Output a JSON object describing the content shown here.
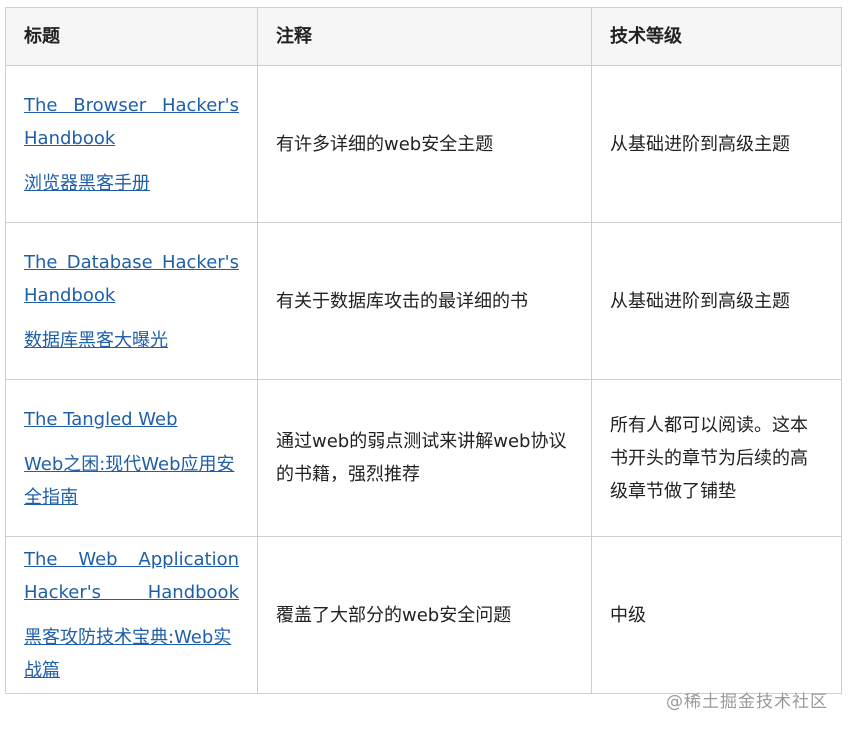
{
  "headers": {
    "title": "标题",
    "note": "注释",
    "level": "技术等级"
  },
  "rows": [
    {
      "title_en": "The Browser Hacker's Handbook",
      "title_cn": "浏览器黑客手册",
      "note": "有许多详细的web安全主题",
      "level": "从基础进阶到高级主题"
    },
    {
      "title_en": "The Database Hacker's Handbook",
      "title_cn": "数据库黑客大曝光",
      "note": "有关于数据库攻击的最详细的书",
      "level": "从基础进阶到高级主题"
    },
    {
      "title_en": "The Tangled Web",
      "title_cn": "Web之困:现代Web应用安全指南",
      "note": "通过web的弱点测试来讲解web协议的书籍，强烈推荐",
      "level": "所有人都可以阅读。这本书开头的章节为后续的高级章节做了铺垫"
    },
    {
      "title_en": "The Web Application Hacker's Handbook",
      "title_cn": "黑客攻防技术宝典:Web实战篇",
      "note": "覆盖了大部分的web安全问题",
      "level": "中级"
    }
  ],
  "watermark": "@稀土掘金技术社区",
  "colors": {
    "link": "#1f5fa8",
    "header_bg": "#f6f6f6",
    "border": "#cfcfcf"
  }
}
